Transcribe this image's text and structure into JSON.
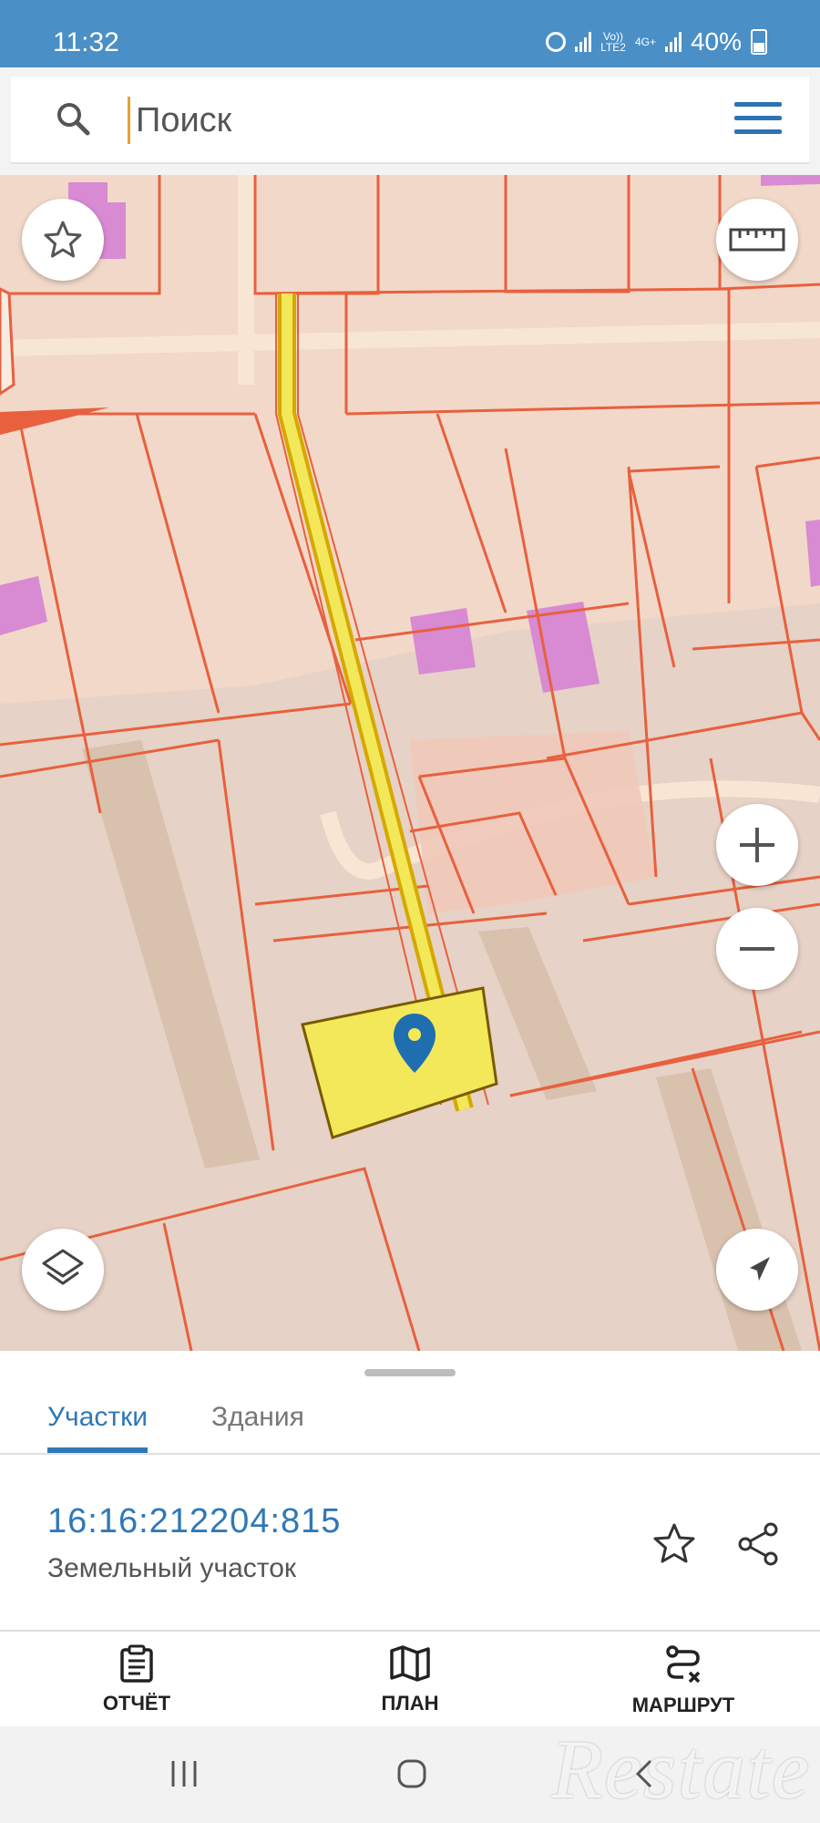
{
  "status": {
    "time": "11:32",
    "network_top": "Vo))",
    "network_bottom": "LTE2",
    "net_type": "4G+",
    "battery": "40%"
  },
  "search": {
    "placeholder": "Поиск",
    "icon": "search-icon",
    "menu_icon": "menu-icon"
  },
  "map": {
    "buttons": [
      "favorites-icon",
      "ruler-icon",
      "zoom-in-icon",
      "zoom-out-icon",
      "layers-icon",
      "locate-icon"
    ],
    "colors": {
      "background": "#f2d8c8",
      "boundary": "#e8603e",
      "selected_fill": "#f2e85a",
      "selected_stroke": "#d6a800",
      "building": "#d88ad2",
      "marker": "#1f6fb0"
    }
  },
  "tabs": [
    {
      "label": "Участки",
      "active": true
    },
    {
      "label": "Здания",
      "active": false
    }
  ],
  "parcel": {
    "number": "16:16:212204:815",
    "type": "Земельный участок"
  },
  "bottom_nav": [
    {
      "label": "ОТЧЁТ",
      "icon": "report-icon"
    },
    {
      "label": "ПЛАН",
      "icon": "map-plan-icon"
    },
    {
      "label": "МАРШРУТ",
      "icon": "route-icon"
    }
  ],
  "watermark": "Restate"
}
